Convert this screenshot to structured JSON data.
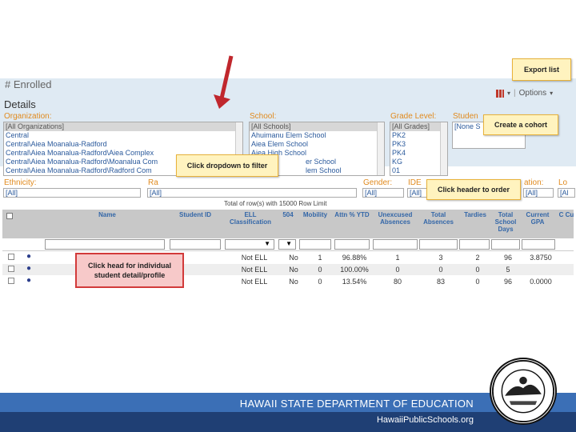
{
  "enrolled_title": "# Enrolled",
  "details_title": "Details",
  "options_label": "Options",
  "filters": {
    "organization": {
      "label": "Organization:",
      "items": [
        "[All Organizations]",
        "Central",
        "Central\\Aiea Moanalua-Radford",
        "Central\\Aiea Moanalua-Radford\\Aiea Complex",
        "Central\\Aiea Moanalua-Radford\\Moanalua Com",
        "Central\\Aiea Moanalua-Radford\\Radford Com"
      ]
    },
    "school": {
      "label": "School:",
      "items": [
        "[All Schools]",
        "Ahuimanu Elem School",
        "Aiea Elem School",
        "Aiea High School",
        "er School",
        "lem School"
      ]
    },
    "grade_level": {
      "label": "Grade Level:",
      "items": [
        "[All Grades]",
        "PK2",
        "PK3",
        "PK4",
        "KG",
        "01"
      ]
    },
    "student": {
      "label": "Studen",
      "value": "[None S"
    },
    "ethnicity": {
      "label": "Ethnicity:",
      "value": "[All]"
    },
    "race": {
      "label": "Ra",
      "value": "[All]"
    },
    "gender": {
      "label": "Gender:",
      "value": "[All]"
    },
    "idea": {
      "label": "IDE",
      "value": "[All]"
    },
    "classification": {
      "label": "ation:",
      "value": "[All]"
    },
    "low": {
      "label": "Lo",
      "value": "[Al"
    }
  },
  "total_row_text": "Total of          row(s) with 15000 Row Limit",
  "columns": [
    "Name",
    "Student ID",
    "ELL Classification",
    "504",
    "Mobility",
    "Attn % YTD",
    "Unexcused Absences",
    "Total Absences",
    "Tardies",
    "Total School Days",
    "Current GPA",
    "C Cu"
  ],
  "rows": [
    {
      "ell": "Not ELL",
      "c504": "No",
      "mobility": "1",
      "attn": "96.88%",
      "unexcused": "1",
      "total_abs": "3",
      "tardies": "2",
      "days": "96",
      "gpa": "3.8750"
    },
    {
      "ell": "Not ELL",
      "c504": "No",
      "mobility": "0",
      "attn": "100.00%",
      "unexcused": "0",
      "total_abs": "0",
      "tardies": "0",
      "days": "5",
      "gpa": ""
    },
    {
      "ell": "Not ELL",
      "c504": "No",
      "mobility": "0",
      "attn": "13.54%",
      "unexcused": "80",
      "total_abs": "83",
      "tardies": "0",
      "days": "96",
      "gpa": "0.0000"
    }
  ],
  "callouts": {
    "export": "Export list",
    "cohort": "Create a cohort",
    "filter": "Click dropdown to filter",
    "header": "Click header to order",
    "head": "Click head for individual student detail/profile"
  },
  "footer": {
    "org": "HAWAII STATE DEPARTMENT OF EDUCATION",
    "site": "HawaiiPublicSchools.org"
  },
  "colors": {
    "footer_top": "#3b6fb6",
    "footer_bottom": "#1f3f74",
    "accent_orange": "#e08a1e",
    "callout_bg": "#fff3bf"
  }
}
